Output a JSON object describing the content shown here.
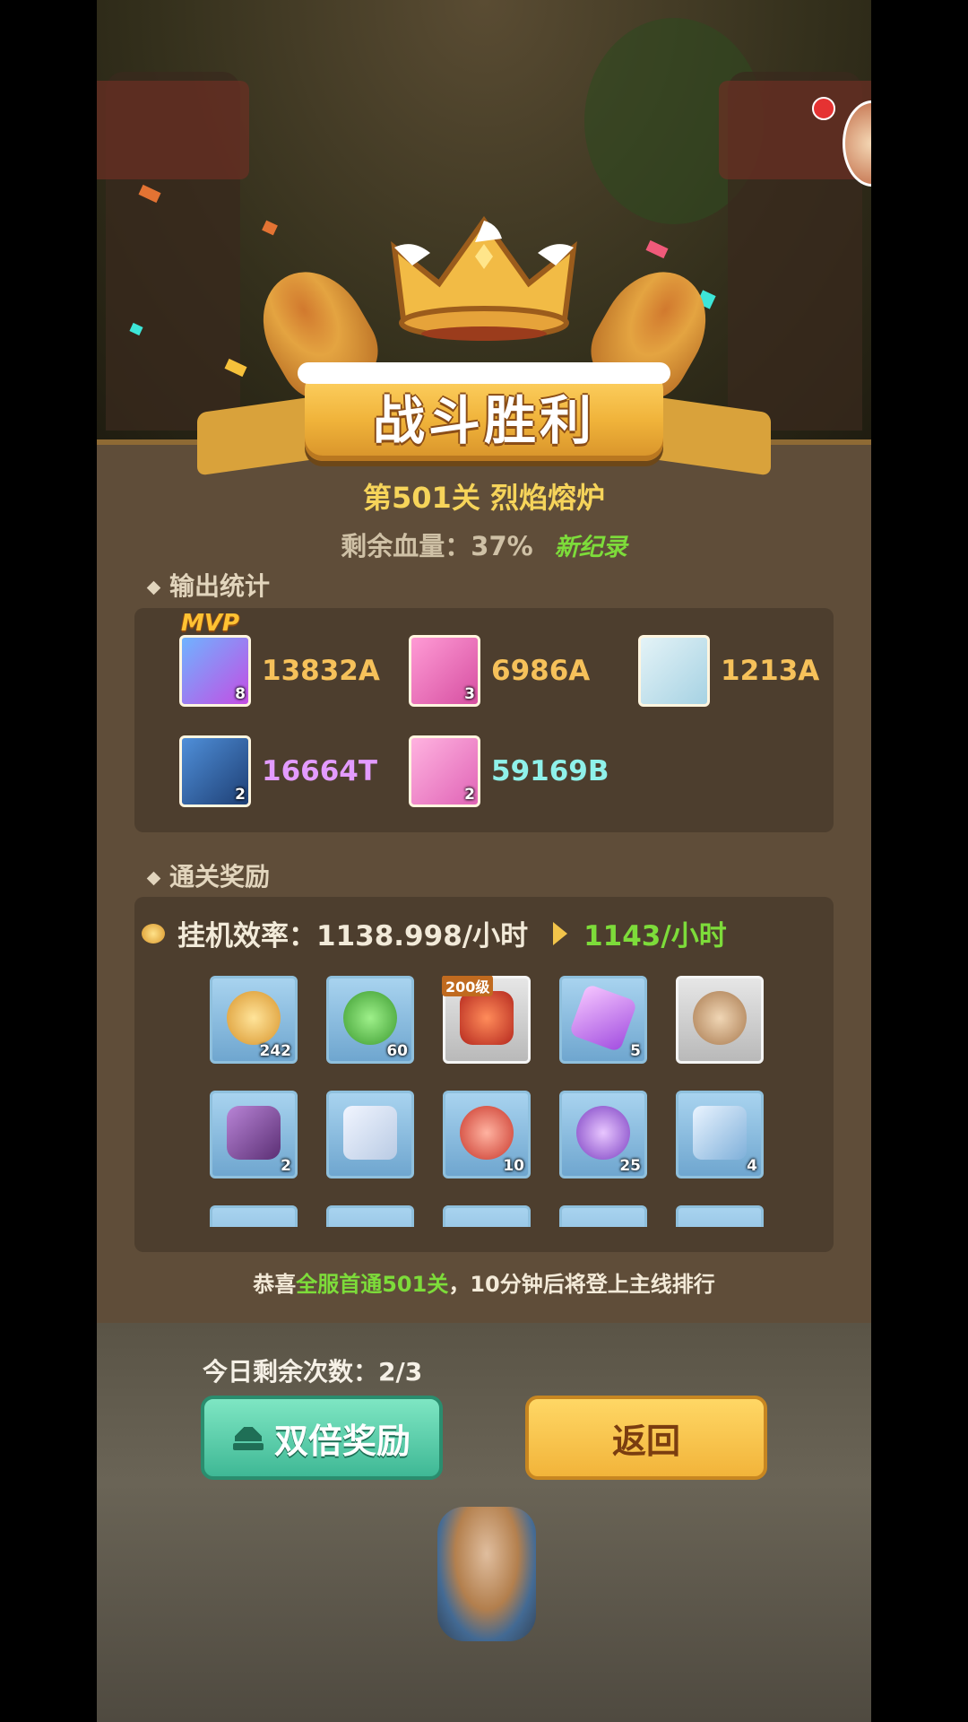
{
  "header": {
    "title": "战斗胜利",
    "stage": "第501关 烈焰熔炉",
    "hp_label": "剩余血量：",
    "hp_value": "37%",
    "new_record": "新纪录"
  },
  "output_stats": {
    "section_title": "输出统计",
    "mvp_label": "MVP",
    "heroes": [
      {
        "damage": "13832A",
        "stars": "8",
        "color": "#f6c15a",
        "portrait": "mecha-hero-icon"
      },
      {
        "damage": "6986A",
        "stars": "3",
        "color": "#f6c15a",
        "portrait": "pink-cat-hero-icon"
      },
      {
        "damage": "1213A",
        "stars": "",
        "color": "#f6c15a",
        "portrait": "king-hero-icon"
      },
      {
        "damage": "16664T",
        "stars": "2",
        "color": "#e39bff",
        "portrait": "dark-knight-hero-icon"
      },
      {
        "damage": "59169B",
        "stars": "2",
        "color": "#8ff1ea",
        "portrait": "angel-hero-icon"
      }
    ]
  },
  "rewards": {
    "section_title": "通关奖励",
    "rate_label": "挂机效率：",
    "rate_value": "1138.998/小时",
    "rate_new": "1143/小时",
    "items": [
      {
        "icon": "gold-coin-icon",
        "count": "242",
        "tag": ""
      },
      {
        "icon": "exp-icon",
        "count": "60",
        "tag": ""
      },
      {
        "icon": "armor-icon",
        "count": "",
        "tag": "200级"
      },
      {
        "icon": "purple-crystal-icon",
        "count": "5",
        "tag": ""
      },
      {
        "icon": "bull-skull-icon",
        "count": "",
        "tag": ""
      },
      {
        "icon": "wood-log-icon",
        "count": "2",
        "tag": ""
      },
      {
        "icon": "scroll-icon",
        "count": "",
        "tag": ""
      },
      {
        "icon": "sword-orb-icon",
        "count": "10",
        "tag": ""
      },
      {
        "icon": "mystery-orb-icon",
        "count": "25",
        "tag": ""
      },
      {
        "icon": "blue-scroll-icon",
        "count": "4",
        "tag": ""
      }
    ]
  },
  "congrats": {
    "prefix": "恭喜",
    "highlight": "全服首通501关",
    "suffix": "，10分钟后将登上主线排行"
  },
  "footer": {
    "remaining_label": "今日剩余次数：",
    "remaining_value": "2/3",
    "double_button": "双倍奖励",
    "back_button": "返回"
  },
  "colors": {
    "accent_gold": "#f6d45a",
    "accent_green": "#7ddc3a",
    "button_green": "#3fb895",
    "button_gold": "#f2b43a"
  }
}
